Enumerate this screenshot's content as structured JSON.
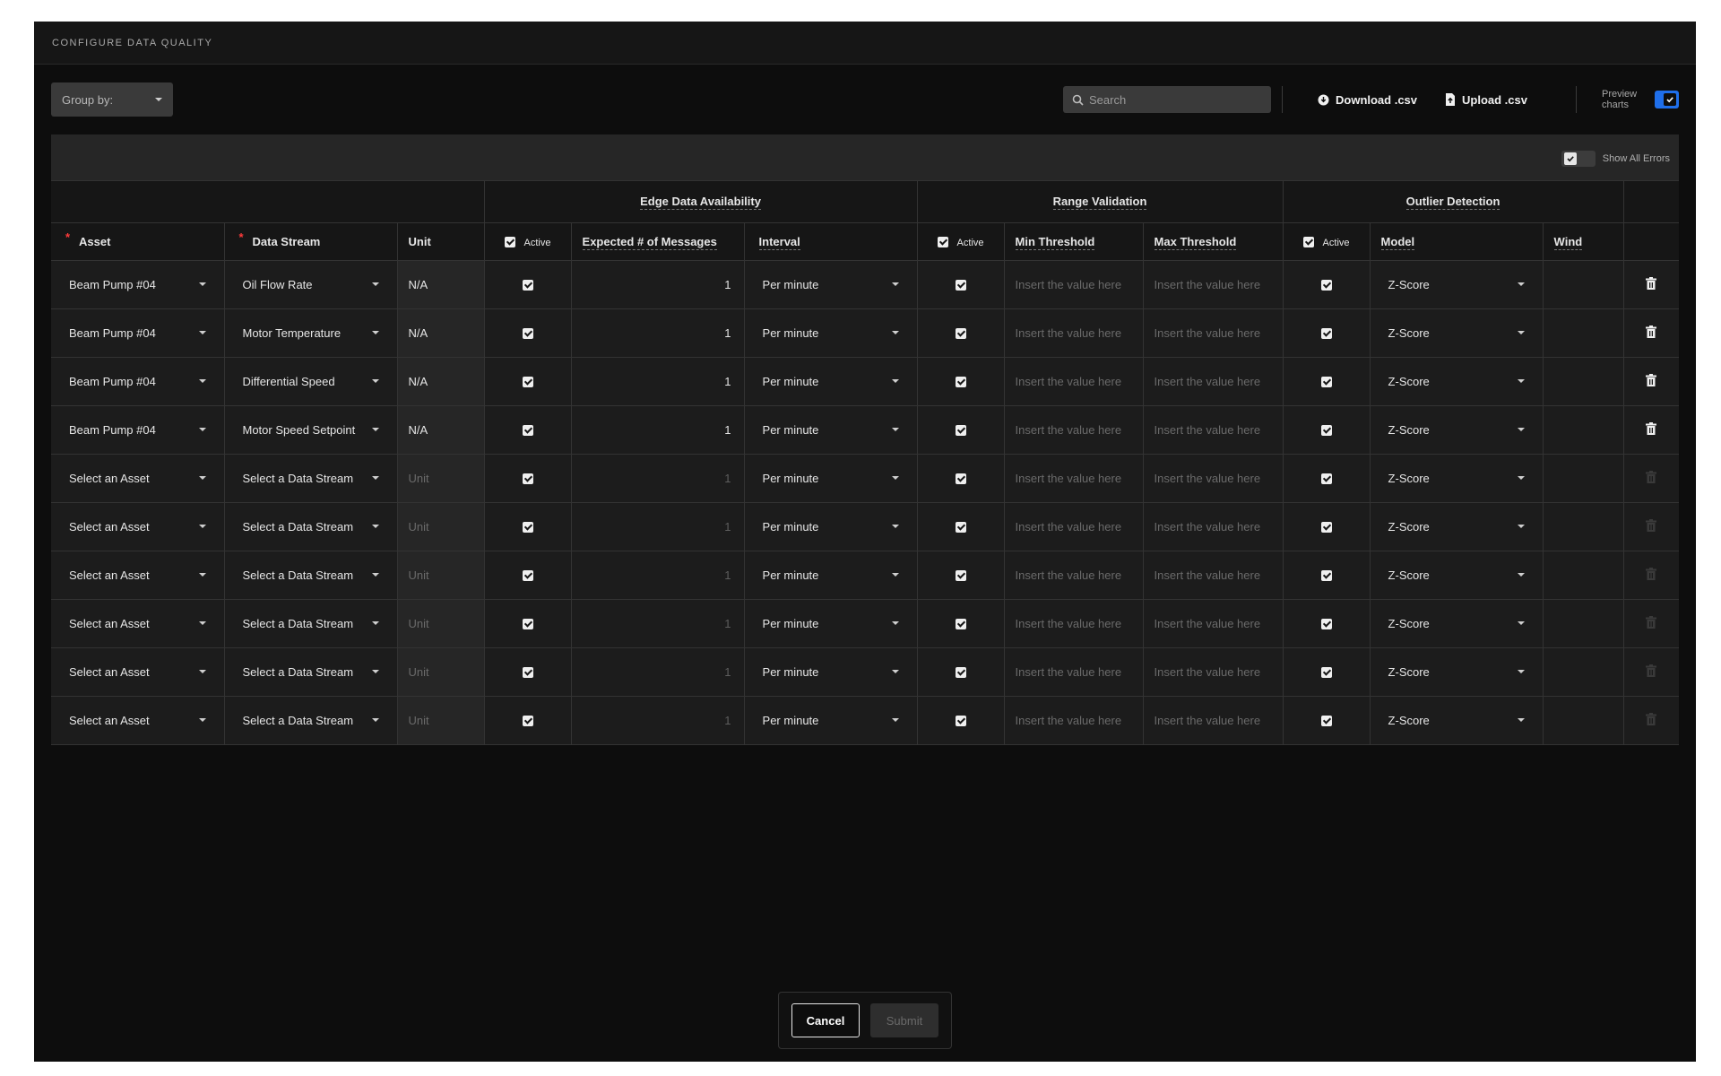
{
  "dialog": {
    "title": "CONFIGURE DATA QUALITY"
  },
  "toolbar": {
    "group_by": "Group by:",
    "search_placeholder": "Search",
    "download_label": "Download .csv",
    "upload_label": "Upload .csv",
    "preview_charts_label": "Preview charts",
    "preview_charts_on": true
  },
  "table": {
    "show_all_errors_label": "Show All Errors",
    "groups": {
      "edge": "Edge Data Availability",
      "range": "Range Validation",
      "outlier": "Outlier Detection"
    },
    "columns": {
      "asset": "Asset",
      "data_stream": "Data Stream",
      "unit": "Unit",
      "active": "Active",
      "expected_messages": "Expected # of Messages",
      "interval": "Interval",
      "min_threshold": "Min Threshold",
      "max_threshold": "Max Threshold",
      "model": "Model",
      "window": "Wind"
    },
    "threshold_placeholder": "Insert the value here",
    "rows": [
      {
        "asset": "Beam Pump #04",
        "stream": "Oil Flow Rate",
        "unit": "N/A",
        "expected": "1",
        "interval": "Per minute",
        "model": "Z-Score",
        "filled": true
      },
      {
        "asset": "Beam Pump #04",
        "stream": "Motor Temperature",
        "unit": "N/A",
        "expected": "1",
        "interval": "Per minute",
        "model": "Z-Score",
        "filled": true
      },
      {
        "asset": "Beam Pump #04",
        "stream": "Differential Speed",
        "unit": "N/A",
        "expected": "1",
        "interval": "Per minute",
        "model": "Z-Score",
        "filled": true
      },
      {
        "asset": "Beam Pump #04",
        "stream": "Motor Speed Setpoint",
        "unit": "N/A",
        "expected": "1",
        "interval": "Per minute",
        "model": "Z-Score",
        "filled": true
      },
      {
        "asset": "Select an Asset",
        "stream": "Select a Data Stream",
        "unit": "Unit",
        "expected": "1",
        "interval": "Per minute",
        "model": "Z-Score",
        "filled": false
      },
      {
        "asset": "Select an Asset",
        "stream": "Select a Data Stream",
        "unit": "Unit",
        "expected": "1",
        "interval": "Per minute",
        "model": "Z-Score",
        "filled": false
      },
      {
        "asset": "Select an Asset",
        "stream": "Select a Data Stream",
        "unit": "Unit",
        "expected": "1",
        "interval": "Per minute",
        "model": "Z-Score",
        "filled": false
      },
      {
        "asset": "Select an Asset",
        "stream": "Select a Data Stream",
        "unit": "Unit",
        "expected": "1",
        "interval": "Per minute",
        "model": "Z-Score",
        "filled": false
      },
      {
        "asset": "Select an Asset",
        "stream": "Select a Data Stream",
        "unit": "Unit",
        "expected": "1",
        "interval": "Per minute",
        "model": "Z-Score",
        "filled": false
      },
      {
        "asset": "Select an Asset",
        "stream": "Select a Data Stream",
        "unit": "Unit",
        "expected": "1",
        "interval": "Per minute",
        "model": "Z-Score",
        "filled": false
      }
    ]
  },
  "footer": {
    "cancel_label": "Cancel",
    "submit_label": "Submit"
  },
  "colors": {
    "accent": "#1f6feb",
    "background": "#0d0d0d",
    "required": "#ff3b3b"
  }
}
